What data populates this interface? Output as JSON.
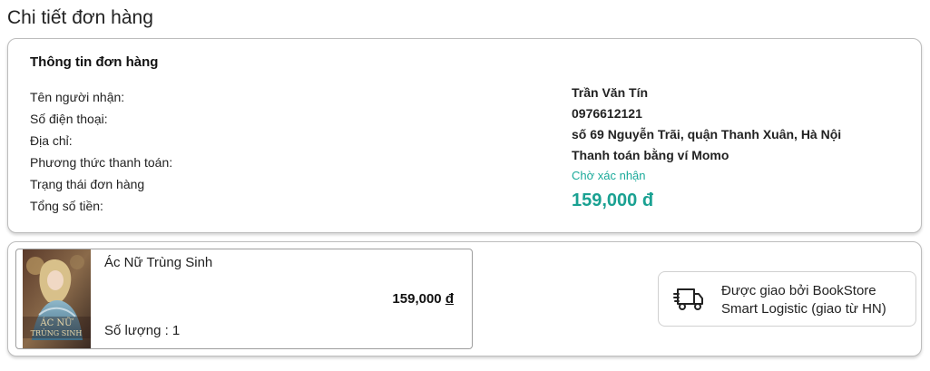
{
  "page": {
    "title": "Chi tiết đơn hàng"
  },
  "order_info": {
    "title": "Thông tin đơn hàng",
    "labels": {
      "recipient": "Tên người nhận:",
      "phone": "Số điện thoại:",
      "address": "Địa chỉ:",
      "payment_method": "Phương thức thanh toán:",
      "status": "Trạng thái đơn hàng",
      "total": "Tổng số tiền:"
    },
    "values": {
      "recipient": "Trần Văn Tín",
      "phone": "0976612121",
      "address": "số 69 Nguyễn Trãi, quận Thanh Xuân, Hà Nội",
      "payment_method": "Thanh toán bằng ví Momo",
      "status": "Chờ xác nhận",
      "total": "159,000 đ"
    },
    "colors": {
      "accent": "#1aa192"
    }
  },
  "items": [
    {
      "name": "Ác Nữ Trùng Sinh",
      "price": "159,000",
      "currency": "đ",
      "quantity_text": "Số lượng : 1",
      "cover_text": "ÁC NỮ TRÙNG SINH"
    }
  ],
  "delivery": {
    "icon": "truck-icon",
    "line1": "Được giao bởi BookStore",
    "line2": "Smart Logistic (giao từ HN)"
  }
}
